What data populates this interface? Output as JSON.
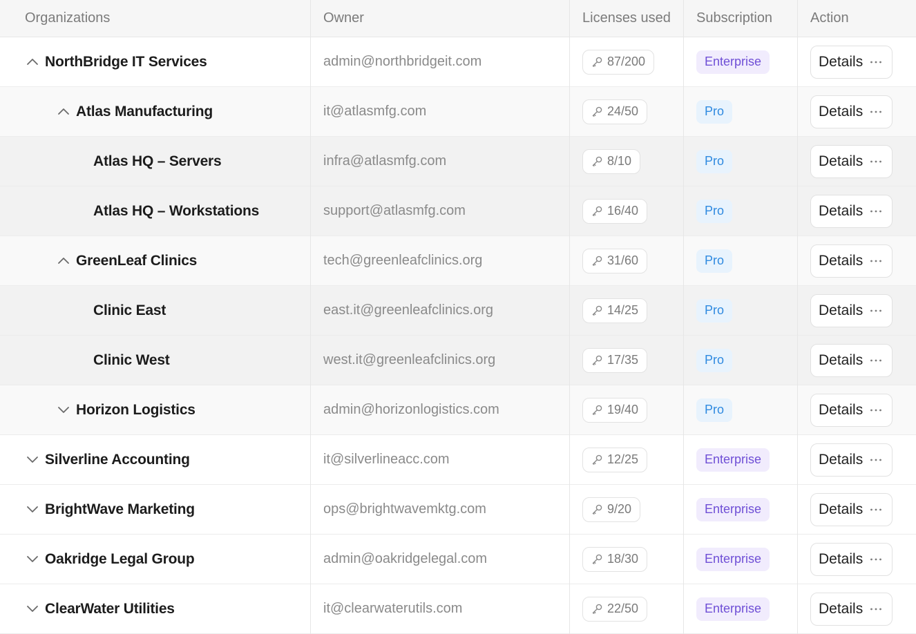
{
  "headers": {
    "organizations": "Organizations",
    "owner": "Owner",
    "licenses": "Licenses used",
    "subscription": "Subscription",
    "action": "Action"
  },
  "rows": [
    {
      "name": "NorthBridge IT Services",
      "owner": "admin@northbridgeit.com",
      "licenses": "87/200",
      "subscription": "Enterprise",
      "tier": "enterprise",
      "level": 0,
      "chevron": "chevron-up-icon",
      "action": "Details"
    },
    {
      "name": "Atlas Manufacturing",
      "owner": "it@atlasmfg.com",
      "licenses": "24/50",
      "subscription": "Pro",
      "tier": "pro",
      "level": 1,
      "chevron": "chevron-up-icon",
      "action": "Details"
    },
    {
      "name": "Atlas HQ – Servers",
      "owner": "infra@atlasmfg.com",
      "licenses": "8/10",
      "subscription": "Pro",
      "tier": "pro",
      "level": 2,
      "chevron": "",
      "action": "Details"
    },
    {
      "name": "Atlas HQ – Workstations",
      "owner": "support@atlasmfg.com",
      "licenses": "16/40",
      "subscription": "Pro",
      "tier": "pro",
      "level": 2,
      "chevron": "",
      "action": "Details"
    },
    {
      "name": "GreenLeaf Clinics",
      "owner": "tech@greenleafclinics.org",
      "licenses": "31/60",
      "subscription": "Pro",
      "tier": "pro",
      "level": 1,
      "chevron": "chevron-up-icon",
      "action": "Details"
    },
    {
      "name": "Clinic East",
      "owner": "east.it@greenleafclinics.org",
      "licenses": "14/25",
      "subscription": "Pro",
      "tier": "pro",
      "level": 2,
      "chevron": "",
      "action": "Details"
    },
    {
      "name": "Clinic West",
      "owner": "west.it@greenleafclinics.org",
      "licenses": "17/35",
      "subscription": "Pro",
      "tier": "pro",
      "level": 2,
      "chevron": "",
      "action": "Details"
    },
    {
      "name": "Horizon Logistics",
      "owner": "admin@horizonlogistics.com",
      "licenses": "19/40",
      "subscription": "Pro",
      "tier": "pro",
      "level": 1,
      "chevron": "chevron-down-icon",
      "action": "Details"
    },
    {
      "name": "Silverline Accounting",
      "owner": "it@silverlineacc.com",
      "licenses": "12/25",
      "subscription": "Enterprise",
      "tier": "enterprise",
      "level": 0,
      "chevron": "chevron-down-icon",
      "action": "Details"
    },
    {
      "name": "BrightWave Marketing",
      "owner": "ops@brightwavemktg.com",
      "licenses": "9/20",
      "subscription": "Enterprise",
      "tier": "enterprise",
      "level": 0,
      "chevron": "chevron-down-icon",
      "action": "Details"
    },
    {
      "name": "Oakridge Legal Group",
      "owner": "admin@oakridgelegal.com",
      "licenses": "18/30",
      "subscription": "Enterprise",
      "tier": "enterprise",
      "level": 0,
      "chevron": "chevron-down-icon",
      "action": "Details"
    },
    {
      "name": "ClearWater Utilities",
      "owner": "it@clearwaterutils.com",
      "licenses": "22/50",
      "subscription": "Enterprise",
      "tier": "enterprise",
      "level": 0,
      "chevron": "chevron-down-icon",
      "action": "Details"
    }
  ],
  "icons": {
    "license": "key-icon",
    "action_more": "more-horizontal-icon"
  },
  "colors": {
    "enterprise_text": "#6f4fd6",
    "enterprise_bg": "#f1ecfd",
    "pro_text": "#2f8ae0",
    "pro_bg": "#e8f3fd"
  }
}
